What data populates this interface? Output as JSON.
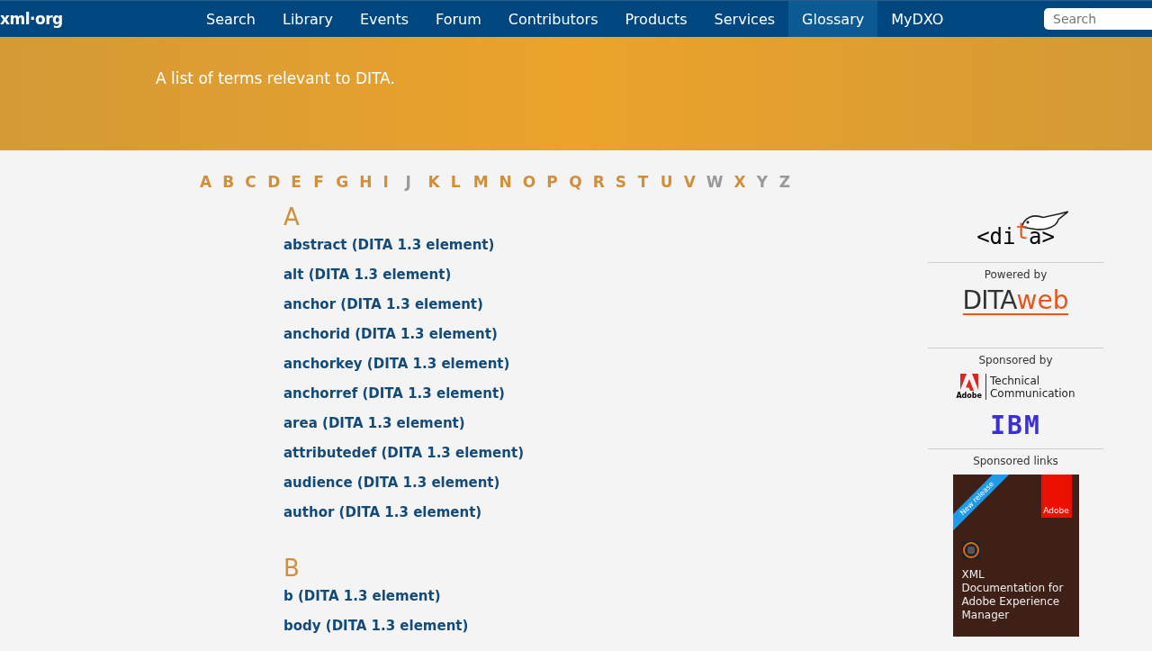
{
  "nav": {
    "logo": "xml·org",
    "items": [
      {
        "label": "Search",
        "selected": false
      },
      {
        "label": "Library",
        "selected": false
      },
      {
        "label": "Events",
        "selected": false
      },
      {
        "label": "Forum",
        "selected": false
      },
      {
        "label": "Contributors",
        "selected": false
      },
      {
        "label": "Products",
        "selected": false
      },
      {
        "label": "Services",
        "selected": false
      },
      {
        "label": "Glossary",
        "selected": true
      },
      {
        "label": "MyDXO",
        "selected": false
      }
    ],
    "search": {
      "placeholder": "Search"
    }
  },
  "banner": {
    "text": "A list of terms relevant to DITA."
  },
  "alphabet": [
    {
      "letter": "A",
      "disabled": false
    },
    {
      "letter": "B",
      "disabled": false
    },
    {
      "letter": "C",
      "disabled": false
    },
    {
      "letter": "D",
      "disabled": false
    },
    {
      "letter": "E",
      "disabled": false
    },
    {
      "letter": "F",
      "disabled": false
    },
    {
      "letter": "G",
      "disabled": false
    },
    {
      "letter": "H",
      "disabled": false
    },
    {
      "letter": "I",
      "disabled": false
    },
    {
      "letter": "J",
      "disabled": true
    },
    {
      "letter": "K",
      "disabled": false
    },
    {
      "letter": "L",
      "disabled": false
    },
    {
      "letter": "M",
      "disabled": false
    },
    {
      "letter": "N",
      "disabled": false
    },
    {
      "letter": "O",
      "disabled": false
    },
    {
      "letter": "P",
      "disabled": false
    },
    {
      "letter": "Q",
      "disabled": false
    },
    {
      "letter": "R",
      "disabled": false
    },
    {
      "letter": "S",
      "disabled": false
    },
    {
      "letter": "T",
      "disabled": false
    },
    {
      "letter": "U",
      "disabled": false
    },
    {
      "letter": "V",
      "disabled": false
    },
    {
      "letter": "W",
      "disabled": true
    },
    {
      "letter": "X",
      "disabled": false
    },
    {
      "letter": "Y",
      "disabled": true
    },
    {
      "letter": "Z",
      "disabled": true
    }
  ],
  "sections": [
    {
      "heading": "A",
      "terms": [
        "abstract (DITA 1.3 element)",
        "alt (DITA 1.3 element)",
        "anchor (DITA 1.3 element)",
        "anchorid (DITA 1.3 element)",
        "anchorkey (DITA 1.3 element)",
        "anchorref (DITA 1.3 element)",
        "area (DITA 1.3 element)",
        "attributedef (DITA 1.3 element)",
        "audience (DITA 1.3 element)",
        "author (DITA 1.3 element)"
      ]
    },
    {
      "heading": "B",
      "terms": [
        "b (DITA 1.3 element)",
        "body (DITA 1.3 element)"
      ]
    }
  ],
  "sidebar": {
    "dita_logo": {
      "left": "<di",
      "t": "t",
      "right": "a>"
    },
    "powered_label": "Powered by",
    "ditaweb_logo": {
      "part1": "DITA",
      "part2": "web"
    },
    "sponsored_label": "Sponsored by",
    "adobe_logo": {
      "mark": "Adobe",
      "line1": "Technical",
      "line2": "Communication"
    },
    "ibm_logo": "IBM",
    "links_label": "Sponsored links",
    "ad": {
      "ribbon": "New release",
      "brand": "Adobe",
      "title": "XML Documentation for Adobe Experience Manager"
    }
  }
}
